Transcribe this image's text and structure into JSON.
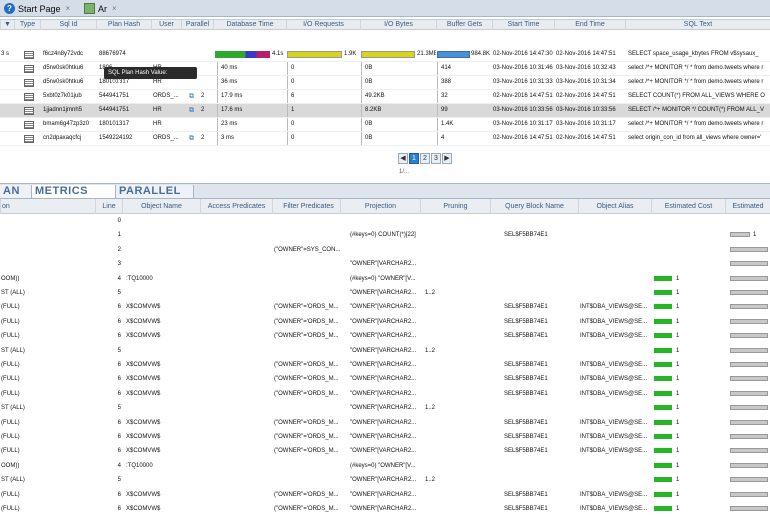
{
  "tabs": [
    {
      "label": "Start Page"
    },
    {
      "label": "Ar"
    }
  ],
  "upper": {
    "headers": [
      "▼",
      "Type",
      "Sql Id",
      "Plan Hash",
      "User",
      "Parallel",
      "Database Time",
      "I/O Requests",
      "I/O Bytes",
      "Buffer Gets",
      "Start Time",
      "End Time",
      "SQL Text"
    ],
    "top_values": {
      "db_time": "4.1s",
      "io_req": "1.9K",
      "io_bytes": "21.3MB",
      "buffer": "984.8K"
    },
    "rows": [
      {
        "dur": "3 s",
        "sqlid": "f6cz4n8y72vdc",
        "plan": "88676974",
        "user": "",
        "par": "",
        "dbtime": "",
        "ioreq": "",
        "iobytes": "",
        "buf": "",
        "start": "02-Nov-2016 14:47:30",
        "end": "02-Nov-2016 14:47:51",
        "text": "SELECT space_usage_kbytes  FROM  v$sysaux_"
      },
      {
        "dur": "",
        "sqlid": "d5rw0sk0htku6",
        "plan": "1806",
        "user": "HR",
        "par": "",
        "dbtime": "40 ms",
        "ioreq": "0",
        "iobytes": "0B",
        "buf": "414",
        "start": "03-Nov-2016 10:31:46",
        "end": "03-Nov-2016 10:32:43",
        "text": "select /*+ MONITOR */ * from demo.tweets where r"
      },
      {
        "dur": "",
        "sqlid": "d5rw0sk0htku6",
        "plan": "180101317",
        "user": "HR",
        "par": "",
        "dbtime": "36 ms",
        "ioreq": "0",
        "iobytes": "0B",
        "buf": "388",
        "start": "03-Nov-2016 10:31:33",
        "end": "03-Nov-2016 10:31:34",
        "text": "select /*+ MONITOR */ * from demo.tweets where r"
      },
      {
        "dur": "",
        "sqlid": "5xbt0z7k01jub",
        "plan": "544941751",
        "user": "ORDS_...",
        "par": "2",
        "dbtime": "17.9 ms",
        "ioreq": "6",
        "iobytes": "49.2KB",
        "buf": "32",
        "start": "02-Nov-2016 14:47:51",
        "end": "02-Nov-2016 14:47:51",
        "text": "SELECT COUNT(*) FROM ALL_VIEWS WHERE O"
      },
      {
        "dur": "",
        "sqlid": "1jjadnn1jmnh5",
        "plan": "544941751",
        "user": "HR",
        "par": "2",
        "dbtime": "17.6 ms",
        "ioreq": "1",
        "iobytes": "8.2KB",
        "buf": "99",
        "start": "03-Nov-2016 10:33:56",
        "end": "03-Nov-2016 10:33:56",
        "text": "SELECT /*+ MONITOR */ COUNT(*) FROM ALL_V"
      },
      {
        "dur": "",
        "sqlid": "bmam6g47zp3z0",
        "plan": "180101317",
        "user": "HR",
        "par": "",
        "dbtime": "23 ms",
        "ioreq": "0",
        "iobytes": "0B",
        "buf": "1.4K",
        "start": "03-Nov-2016 10:31:17",
        "end": "03-Nov-2016 10:31:17",
        "text": "select /*+ MONITOR */ * from demo.tweets where r"
      },
      {
        "dur": "",
        "sqlid": "cn2dpaxaqcfcj",
        "plan": "1549224192",
        "user": "ORDS_...",
        "par": "2",
        "dbtime": "3 ms",
        "ioreq": "0",
        "iobytes": "0B",
        "buf": "4",
        "start": "02-Nov-2016 14:47:51",
        "end": "02-Nov-2016 14:47:51",
        "text": "select origin_con_id from all_views where owner='"
      }
    ],
    "tooltip": "SQL Plan Hash Value: 180101317",
    "pages": [
      "1",
      "2",
      "3"
    ],
    "page_info": "1/..."
  },
  "lower": {
    "tabs": [
      "AN",
      "METRICS",
      "PARALLEL"
    ],
    "headers": [
      "on",
      "Line",
      "Object Name",
      "Access Predicates",
      "Filter Predicates",
      "Projection",
      "Pruning",
      "Query Block Name",
      "Object Alias",
      "Estimated Cost",
      "Estimated"
    ],
    "rows": [
      {
        "op": "",
        "line": "0",
        "obj": "",
        "acc": "",
        "filt": "",
        "proj": "",
        "prun": "",
        "qb": "",
        "alias": "",
        "cost": "",
        "est": ""
      },
      {
        "op": "",
        "line": "1",
        "obj": "",
        "acc": "",
        "filt": "",
        "proj": "(#keys=0) COUNT(*)[22]",
        "prun": "",
        "qb": "SEL$F5BB74E1",
        "alias": "",
        "cost": "",
        "est": "1"
      },
      {
        "op": "",
        "line": "2",
        "obj": "",
        "acc": "",
        "filt": "(\"OWNER\"=SYS_CON...",
        "proj": "",
        "prun": "",
        "qb": "",
        "alias": "",
        "cost": "",
        "est": ""
      },
      {
        "op": "",
        "line": "3",
        "obj": "",
        "acc": "",
        "filt": "",
        "proj": "\"OWNER\"[VARCHAR2...",
        "prun": "",
        "qb": "",
        "alias": "",
        "cost": "",
        "est": ""
      },
      {
        "op": "OOM))",
        "line": "4",
        "obj": ":TQ10000",
        "acc": "",
        "filt": "",
        "proj": "(#keys=0) \"OWNER\"[V...",
        "prun": "",
        "qb": "",
        "alias": "",
        "cost": "1",
        "est": ""
      },
      {
        "op": "ST (ALL)",
        "line": "5",
        "obj": "",
        "acc": "",
        "filt": "",
        "proj": "\"OWNER\"[VARCHAR2...",
        "prun": "1..2",
        "qb": "",
        "alias": "",
        "cost": "1",
        "est": ""
      },
      {
        "op": "(FULL)",
        "line": "6",
        "obj": "X$COMVW$",
        "acc": "",
        "filt": "(\"OWNER\"='ORDS_M...",
        "proj": "\"OWNER\"[VARCHAR2...",
        "prun": "",
        "qb": "SEL$F5BB74E1",
        "alias": "INT$DBA_VIEWS@SE...",
        "cost": "1",
        "est": ""
      },
      {
        "op": "(FULL)",
        "line": "6",
        "obj": "X$COMVW$",
        "acc": "",
        "filt": "(\"OWNER\"='ORDS_M...",
        "proj": "\"OWNER\"[VARCHAR2...",
        "prun": "",
        "qb": "SEL$F5BB74E1",
        "alias": "INT$DBA_VIEWS@SE...",
        "cost": "1",
        "est": ""
      },
      {
        "op": "(FULL)",
        "line": "6",
        "obj": "X$COMVW$",
        "acc": "",
        "filt": "(\"OWNER\"='ORDS_M...",
        "proj": "\"OWNER\"[VARCHAR2...",
        "prun": "",
        "qb": "SEL$F5BB74E1",
        "alias": "INT$DBA_VIEWS@SE...",
        "cost": "1",
        "est": ""
      },
      {
        "op": "ST (ALL)",
        "line": "5",
        "obj": "",
        "acc": "",
        "filt": "",
        "proj": "\"OWNER\"[VARCHAR2...",
        "prun": "1..2",
        "qb": "",
        "alias": "",
        "cost": "1",
        "est": ""
      },
      {
        "op": "(FULL)",
        "line": "6",
        "obj": "X$COMVW$",
        "acc": "",
        "filt": "(\"OWNER\"='ORDS_M...",
        "proj": "\"OWNER\"[VARCHAR2...",
        "prun": "",
        "qb": "SEL$F5BB74E1",
        "alias": "INT$DBA_VIEWS@SE...",
        "cost": "1",
        "est": ""
      },
      {
        "op": "(FULL)",
        "line": "6",
        "obj": "X$COMVW$",
        "acc": "",
        "filt": "(\"OWNER\"='ORDS_M...",
        "proj": "\"OWNER\"[VARCHAR2...",
        "prun": "",
        "qb": "SEL$F5BB74E1",
        "alias": "INT$DBA_VIEWS@SE...",
        "cost": "1",
        "est": ""
      },
      {
        "op": "(FULL)",
        "line": "6",
        "obj": "X$COMVW$",
        "acc": "",
        "filt": "(\"OWNER\"='ORDS_M...",
        "proj": "\"OWNER\"[VARCHAR2...",
        "prun": "",
        "qb": "SEL$F5BB74E1",
        "alias": "INT$DBA_VIEWS@SE...",
        "cost": "1",
        "est": ""
      },
      {
        "op": "ST (ALL)",
        "line": "5",
        "obj": "",
        "acc": "",
        "filt": "",
        "proj": "\"OWNER\"[VARCHAR2...",
        "prun": "1..2",
        "qb": "",
        "alias": "",
        "cost": "1",
        "est": ""
      },
      {
        "op": "(FULL)",
        "line": "6",
        "obj": "X$COMVW$",
        "acc": "",
        "filt": "(\"OWNER\"='ORDS_M...",
        "proj": "\"OWNER\"[VARCHAR2...",
        "prun": "",
        "qb": "SEL$F5BB74E1",
        "alias": "INT$DBA_VIEWS@SE...",
        "cost": "1",
        "est": ""
      },
      {
        "op": "(FULL)",
        "line": "6",
        "obj": "X$COMVW$",
        "acc": "",
        "filt": "(\"OWNER\"='ORDS_M...",
        "proj": "\"OWNER\"[VARCHAR2...",
        "prun": "",
        "qb": "SEL$F5BB74E1",
        "alias": "INT$DBA_VIEWS@SE...",
        "cost": "1",
        "est": ""
      },
      {
        "op": "(FULL)",
        "line": "6",
        "obj": "X$COMVW$",
        "acc": "",
        "filt": "(\"OWNER\"='ORDS_M...",
        "proj": "\"OWNER\"[VARCHAR2...",
        "prun": "",
        "qb": "SEL$F5BB74E1",
        "alias": "INT$DBA_VIEWS@SE...",
        "cost": "1",
        "est": ""
      },
      {
        "op": "OOM))",
        "line": "4",
        "obj": ":TQ10000",
        "acc": "",
        "filt": "",
        "proj": "(#keys=0) \"OWNER\"[V...",
        "prun": "",
        "qb": "",
        "alias": "",
        "cost": "1",
        "est": ""
      },
      {
        "op": "ST (ALL)",
        "line": "5",
        "obj": "",
        "acc": "",
        "filt": "",
        "proj": "\"OWNER\"[VARCHAR2...",
        "prun": "1..2",
        "qb": "",
        "alias": "",
        "cost": "1",
        "est": ""
      },
      {
        "op": "(FULL)",
        "line": "6",
        "obj": "X$COMVW$",
        "acc": "",
        "filt": "(\"OWNER\"='ORDS_M...",
        "proj": "\"OWNER\"[VARCHAR2...",
        "prun": "",
        "qb": "SEL$F5BB74E1",
        "alias": "INT$DBA_VIEWS@SE...",
        "cost": "1",
        "est": ""
      },
      {
        "op": "(FULL)",
        "line": "6",
        "obj": "X$COMVW$",
        "acc": "",
        "filt": "(\"OWNER\"='ORDS_M...",
        "proj": "\"OWNER\"[VARCHAR2...",
        "prun": "",
        "qb": "SEL$F5BB74E1",
        "alias": "INT$DBA_VIEWS@SE...",
        "cost": "1",
        "est": ""
      }
    ]
  }
}
